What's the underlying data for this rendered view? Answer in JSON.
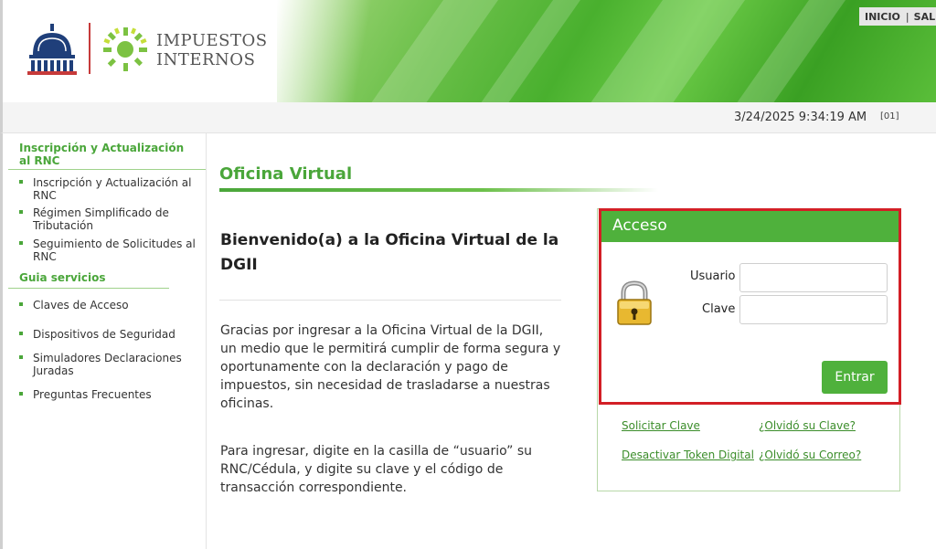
{
  "header": {
    "logo_line1": "IMPUESTOS",
    "logo_line2": "INTERNOS",
    "nav": [
      {
        "label": "INICIO"
      },
      {
        "label": "SALIR"
      }
    ]
  },
  "datebar": {
    "datetime": "3/24/2025 9:34:19 AM",
    "code": "[01]"
  },
  "sidebar": {
    "section1_title": "Inscripción y Actualización al RNC",
    "section1_items": [
      {
        "label": "Inscripción y Actualización al RNC"
      },
      {
        "label": "Régimen Simplificado de Tributación"
      },
      {
        "label": "Seguimiento de Solicitudes al RNC"
      }
    ],
    "section2_title": "Guia servicios",
    "section2_items": [
      {
        "label": "Claves de Acceso"
      },
      {
        "label": "Dispositivos de Seguridad"
      },
      {
        "label": "Simuladores Declaraciones Juradas"
      },
      {
        "label": "Preguntas Frecuentes"
      }
    ]
  },
  "main": {
    "title": "Oficina Virtual",
    "welcome": "Bienvenido(a) a la Oficina Virtual de la DGII",
    "para1": "Gracias por ingresar a la Oficina Virtual de la DGII, un medio que le permitirá cumplir de forma segura y oportunamente con la declaración y pago de impuestos, sin necesidad de trasladarse a nuestras oficinas.",
    "para2": "Para ingresar, digite en la casilla de “usuario” su RNC/Cédula, y digite su clave y el código de transacción correspondiente."
  },
  "login": {
    "heading": "Acceso",
    "usuario_label": "Usuario",
    "usuario_value": "",
    "clave_label": "Clave",
    "clave_value": "",
    "submit_label": "Entrar",
    "links": {
      "solicitar_clave": "Solicitar Clave",
      "olvido_clave": "¿Olvidó su Clave?",
      "desactivar_token": "Desactivar Token Digital",
      "olvido_correo": "¿Olvidó su Correo?"
    }
  },
  "colors": {
    "accent_green": "#4fb13c",
    "highlight_red": "#d31f26"
  }
}
